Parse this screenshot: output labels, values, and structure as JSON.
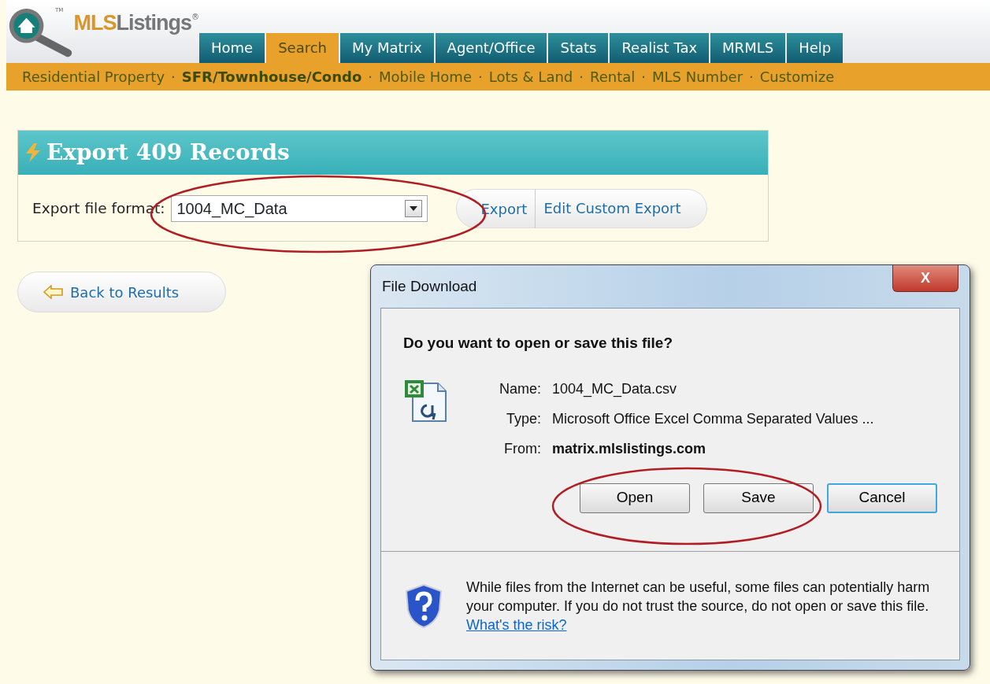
{
  "logo": {
    "text": "MLSListings",
    "trademark": "TM",
    "registered": "®"
  },
  "tabs": [
    {
      "label": "Home",
      "selected": false
    },
    {
      "label": "Search",
      "selected": true
    },
    {
      "label": "My Matrix",
      "selected": false
    },
    {
      "label": "Agent/Office",
      "selected": false
    },
    {
      "label": "Stats",
      "selected": false
    },
    {
      "label": "Realist Tax",
      "selected": false
    },
    {
      "label": "MRMLS",
      "selected": false
    },
    {
      "label": "Help",
      "selected": false
    }
  ],
  "subnav": [
    {
      "label": "Residential Property",
      "selected": false
    },
    {
      "label": "SFR/Townhouse/Condo",
      "selected": true
    },
    {
      "label": "Mobile Home",
      "selected": false
    },
    {
      "label": "Lots & Land",
      "selected": false
    },
    {
      "label": "Rental",
      "selected": false
    },
    {
      "label": "MLS Number",
      "selected": false
    },
    {
      "label": "Customize",
      "selected": false
    }
  ],
  "subnav_separator": "·",
  "export_panel": {
    "title": "Export 409 Records",
    "format_label": "Export file format:",
    "format_value": "1004_MC_Data",
    "actions": [
      "Export",
      "Edit Custom Export"
    ]
  },
  "back_button": "Back to Results",
  "dialog": {
    "title": "File Download",
    "close": "X",
    "question": "Do you want to open or save this file?",
    "fields": [
      {
        "label": "Name:",
        "value": "1004_MC_Data.csv",
        "bold": false
      },
      {
        "label": "Type:",
        "value": "Microsoft Office Excel Comma Separated Values ...",
        "bold": false
      },
      {
        "label": "From:",
        "value": "matrix.mlslistings.com",
        "bold": true
      }
    ],
    "buttons": [
      {
        "label": "Open",
        "default": false
      },
      {
        "label": "Save",
        "default": false
      },
      {
        "label": "Cancel",
        "default": true
      }
    ],
    "warning": "While files from the Internet can be useful, some files can potentially harm your computer. If you do not trust the source, do not open or save this file.",
    "warning_link": "What's the risk?"
  }
}
